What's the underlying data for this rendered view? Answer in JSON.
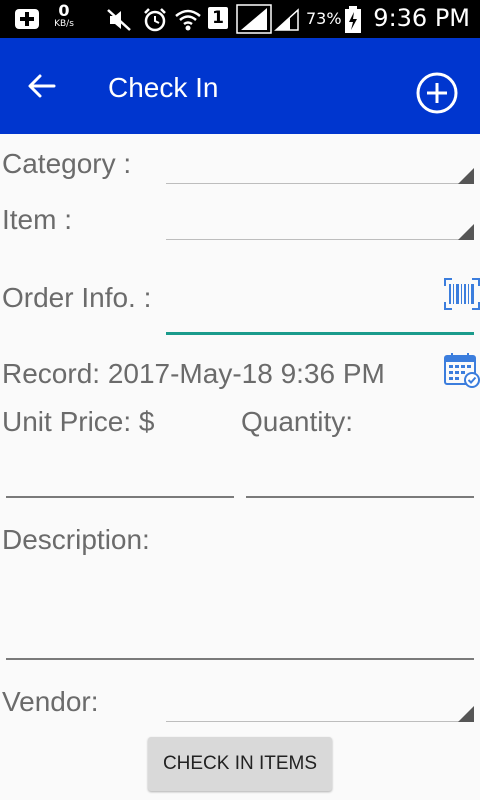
{
  "status_bar": {
    "kbs_value": "0",
    "kbs_unit": "KB/s",
    "sim_label": "1",
    "battery_percent": "73%",
    "time": "9:36 PM"
  },
  "app_bar": {
    "title": "Check In",
    "color": "#0036cf"
  },
  "form": {
    "category_label": "Category :",
    "item_label": "Item :",
    "order_info_label": "Order Info. :",
    "record_label": "Record: 2017-May-18 9:36 PM",
    "unit_price_label": "Unit Price: $",
    "quantity_label": "Quantity:",
    "description_label": "Description:",
    "vendor_label": "Vendor:"
  },
  "actions": {
    "check_in_label": "CHECK IN ITEMS"
  },
  "icons": {
    "back": "arrow-left-icon",
    "add": "plus-circle-icon",
    "barcode": "barcode-icon",
    "calendar": "calendar-icon"
  }
}
